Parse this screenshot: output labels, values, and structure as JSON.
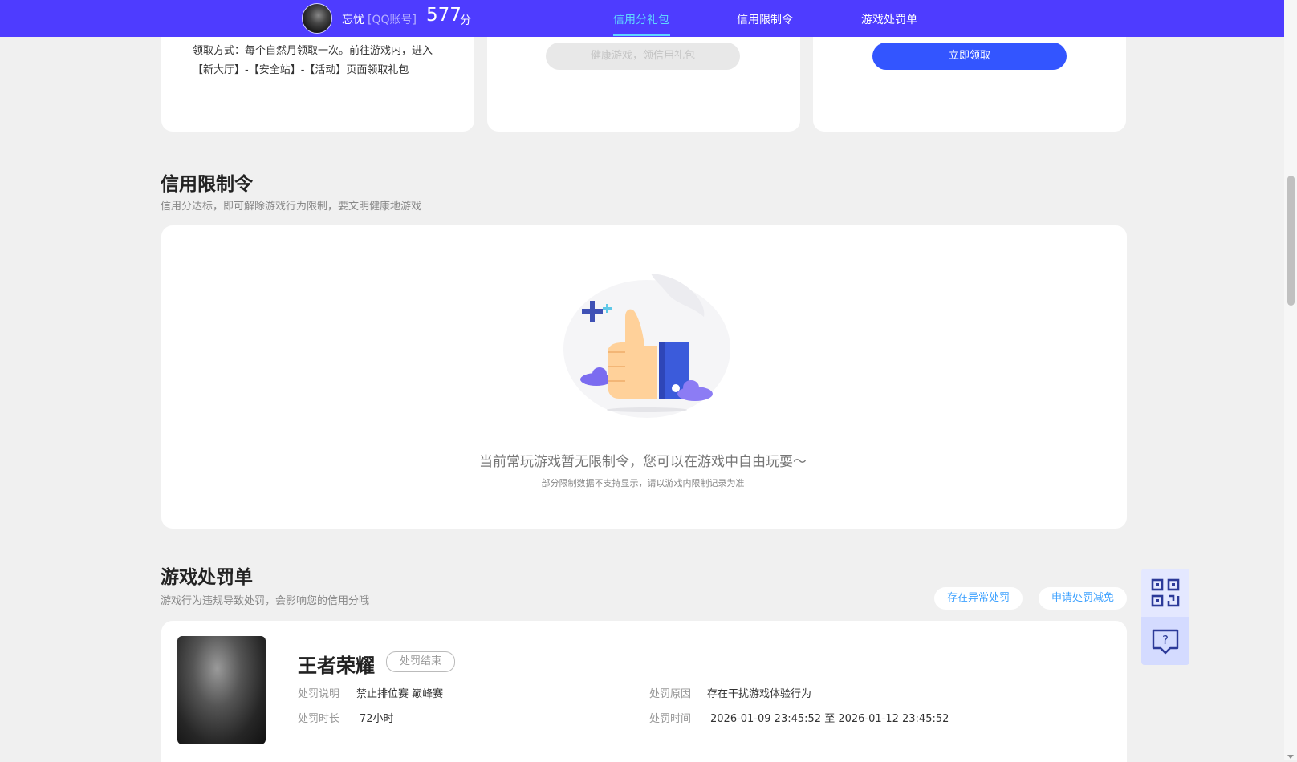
{
  "header": {
    "username": "忘忧",
    "account_type": "[QQ账号]",
    "score": "577",
    "score_unit": "分",
    "nav": [
      {
        "label": "信用分礼包"
      },
      {
        "label": "信用限制令"
      },
      {
        "label": "游戏处罚单"
      }
    ]
  },
  "gift_section": {
    "note": "领取方式：每个自然月领取一次。前往游戏内，进入【新大厅】-【安全站】-【活动】页面领取礼包",
    "disabled_button": "健康游戏，领信用礼包",
    "claim_button": "立即领取"
  },
  "restriction_section": {
    "title": "信用限制令",
    "subtitle": "信用分达标，即可解除游戏行为限制，要文明健康地游戏",
    "empty_text": "当前常玩游戏暂无限制令，您可以在游戏中自由玩耍～",
    "empty_subtext": "部分限制数据不支持显示，请以游戏内限制记录为准"
  },
  "penalty_section": {
    "title": "游戏处罚单",
    "subtitle": "游戏行为违规导致处罚，会影响您的信用分哦",
    "abnormal_button": "存在异常处罚",
    "appeal_button": "申请处罚减免",
    "item": {
      "game": "王者荣耀",
      "status": "处罚结束",
      "desc_label": "处罚说明",
      "desc_value": "禁止排位赛 巅峰赛",
      "duration_label": "处罚时长",
      "duration_value": "72小时",
      "reason_label": "处罚原因",
      "reason_value": "存在干扰游戏体验行为",
      "time_label": "处罚时间",
      "time_value": "2026-01-09 23:45:52 至 2026-01-12 23:45:52"
    }
  },
  "colors": {
    "header_bg": "#4e3cff",
    "nav_active": "#5fd7ff",
    "primary_button": "#3355ff",
    "pill_text": "#3fa2ff"
  },
  "icons": [
    "qrcode-icon",
    "help-chat-icon",
    "thumbs-up-illustration"
  ]
}
